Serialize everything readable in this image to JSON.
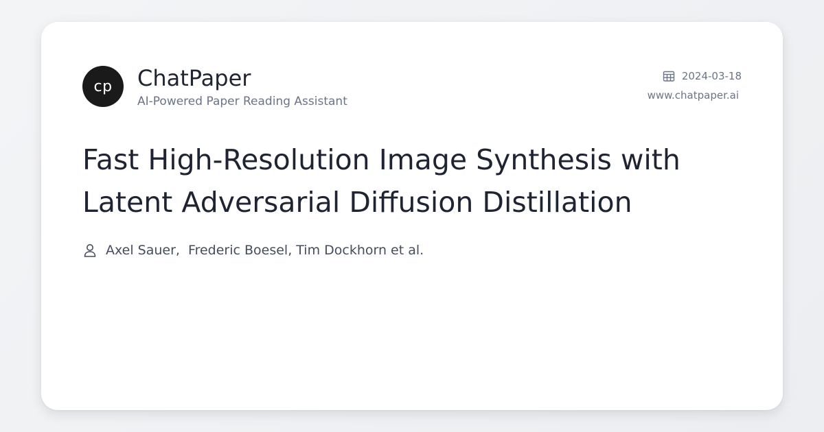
{
  "brand": {
    "logo_text": "cp",
    "name": "ChatPaper",
    "tagline": "AI-Powered Paper Reading Assistant"
  },
  "meta": {
    "date": "2024-03-18",
    "website": "www.chatpaper.ai",
    "date_icon": "calendar-icon"
  },
  "paper": {
    "title": "Fast High-Resolution Image Synthesis with Latent Adversarial Diffusion Distillation",
    "authors": "Axel Sauer,  Frederic Boesel, Tim Dockhorn et al.",
    "authors_icon": "user-icon"
  },
  "colors": {
    "background": "#f3f4f6",
    "card": "#ffffff",
    "logo_bg": "#1a1a1a",
    "text_primary": "#1f2433",
    "text_secondary": "#6b7486"
  }
}
